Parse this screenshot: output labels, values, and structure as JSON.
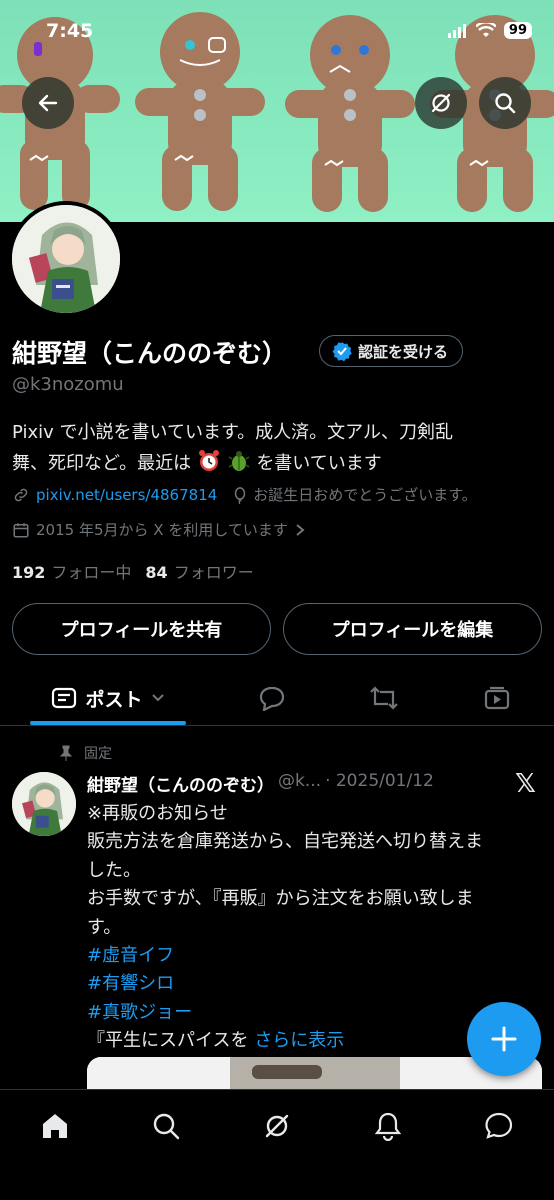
{
  "status": {
    "time": "7:45",
    "battery": "99"
  },
  "profile": {
    "name": "紺野望（こんののぞむ）",
    "verify_label": "認証を受ける",
    "handle": "@k3nozomu",
    "bio_line1": "Pixiv で小説を書いています。成人済。文アル、刀剣乱",
    "bio_line2_a": "舞、死印など。最近は",
    "bio_line2_b": "を書いています",
    "link": "pixiv.net/users/4867814",
    "birthday": "お誕生日おめでとうございます。",
    "joined": "2015 年5月から X を利用しています",
    "following_count": "192",
    "following_label": "フォロー中",
    "followers_count": "84",
    "followers_label": "フォロワー"
  },
  "actions": {
    "share": "プロフィールを共有",
    "edit": "プロフィールを編集"
  },
  "tabs": {
    "posts": "ポスト"
  },
  "post": {
    "pinned_label": "固定",
    "author_name": "紺野望（こんののぞむ）",
    "author_handle": "@k...",
    "date": "· 2025/01/12",
    "lines": [
      "※再販のお知らせ",
      "販売方法を倉庫発送から、自宅発送へ切り替えま",
      "した。",
      "お手数ですが、『再販』から注文をお願い致しま",
      "す。"
    ],
    "hashtags": [
      "#虚音イフ",
      "#有響シロ",
      "#真歌ジョー"
    ],
    "last_line": "『平生にスパイスを",
    "show_more": "さらに表示"
  },
  "colors": {
    "accent": "#1d9bf0",
    "banner": "#8ff0c4",
    "muted": "#71767b"
  },
  "icons": [
    "back-arrow-icon",
    "grok-icon",
    "search-icon",
    "home-icon",
    "bell-icon",
    "messages-icon"
  ]
}
